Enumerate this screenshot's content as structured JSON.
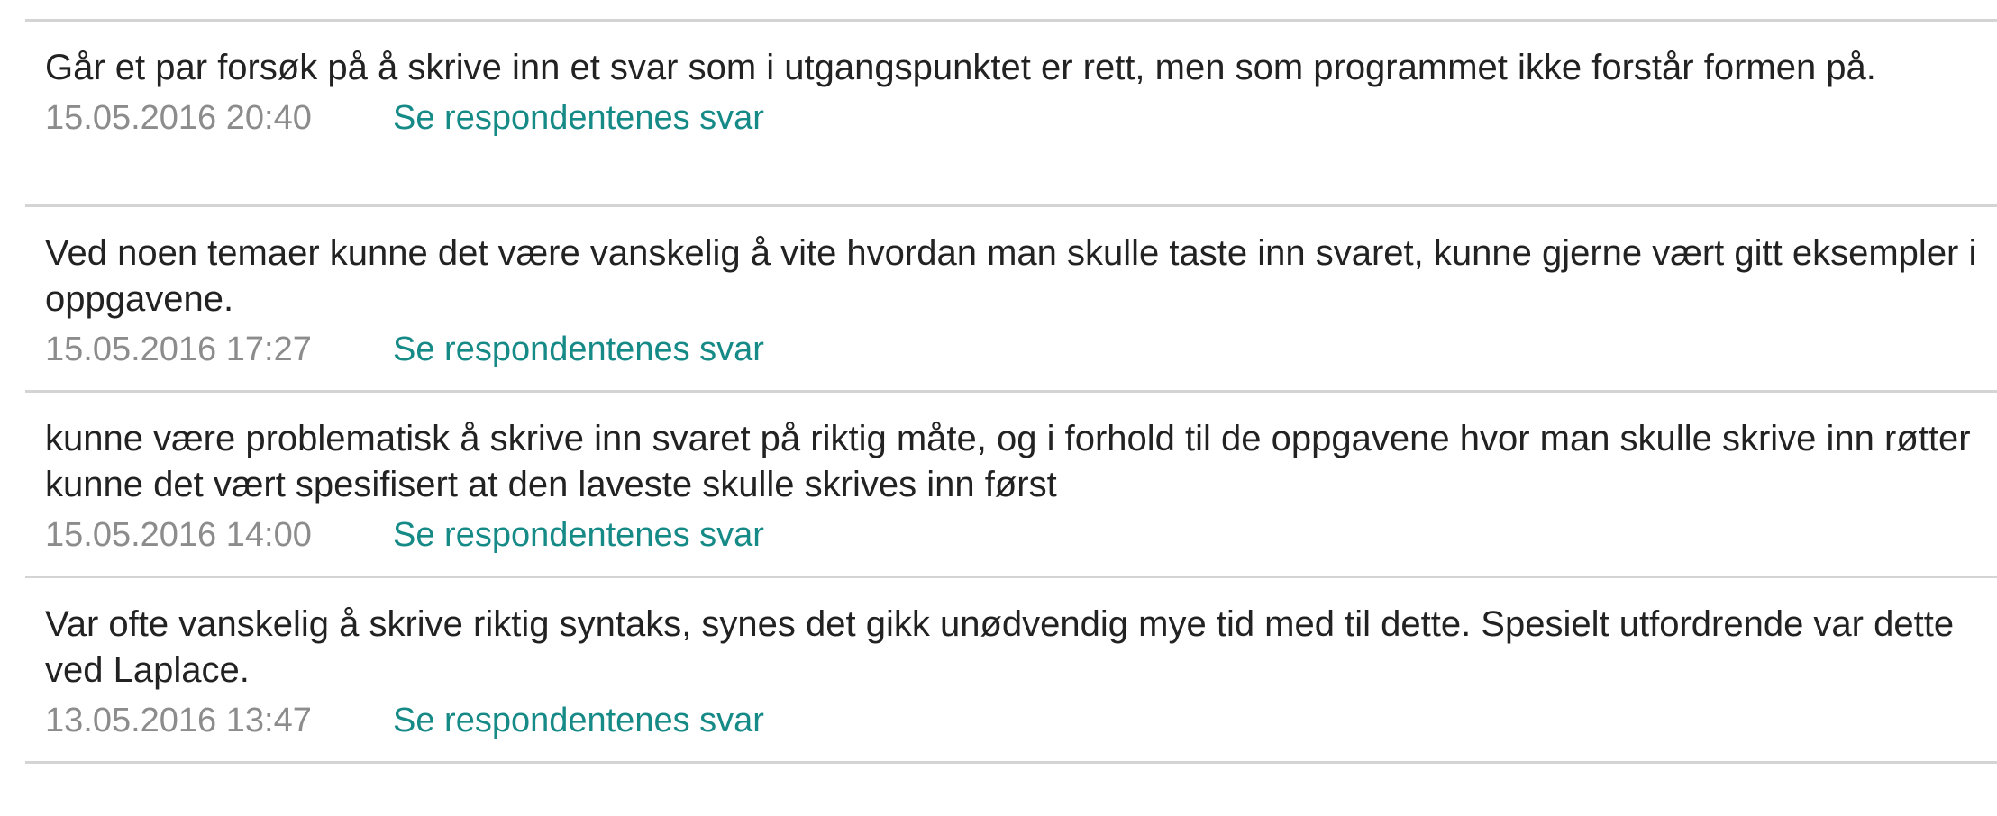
{
  "feedback_list": {
    "link_color": "#168a87",
    "items": [
      {
        "comment": "Går et par forsøk på å skrive inn et svar som i utgangspunktet er rett, men som programmet ikke forstår formen på.",
        "timestamp": "15.05.2016 20:40",
        "link_label": "Se respondentenes svar"
      },
      {
        "comment": "Ved noen temaer kunne det være vanskelig å vite hvordan man skulle taste inn svaret, kunne gjerne vært gitt eksempler i oppgavene.",
        "timestamp": "15.05.2016 17:27",
        "link_label": "Se respondentenes svar"
      },
      {
        "comment": "kunne være problematisk å skrive inn svaret på riktig måte, og i forhold til de oppgavene hvor man skulle skrive inn røtter kunne det vært spesifisert at den laveste skulle skrives inn først",
        "timestamp": "15.05.2016 14:00",
        "link_label": "Se respondentenes svar"
      },
      {
        "comment": "Var ofte vanskelig å skrive riktig syntaks, synes det gikk unødvendig mye tid med til dette. Spesielt utfordrende var dette ved Laplace.",
        "timestamp": "13.05.2016 13:47",
        "link_label": "Se respondentenes svar"
      }
    ]
  }
}
